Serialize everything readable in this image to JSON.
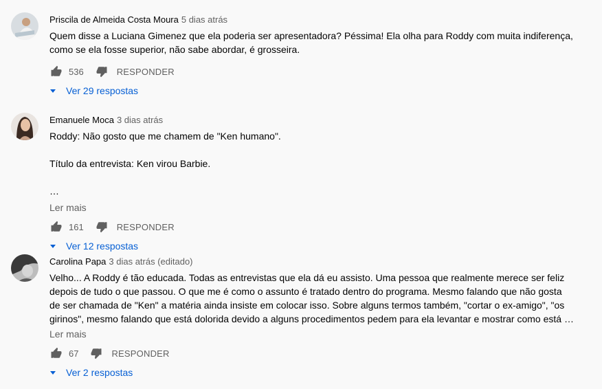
{
  "comments": [
    {
      "author": "Priscila de Almeida Costa Moura",
      "time": "5 dias atrás",
      "text": "Quem disse a Luciana Gimenez que ela poderia ser apresentadora? Péssima! Ela olha para Roddy com muita indiferença, como se ela fosse superior, não sabe abordar, é grosseira.",
      "likes": "536",
      "reply_label": "RESPONDER",
      "replies_label": "Ver 29 respostas"
    },
    {
      "author": "Emanuele Moca",
      "time": "3 dias atrás",
      "text": "Roddy: Não gosto que me chamem de \"Ken humano\".\n\nTítulo da entrevista: Ken virou Barbie.\n\n…",
      "read_more": "Ler mais",
      "likes": "161",
      "reply_label": "RESPONDER",
      "replies_label": "Ver 12 respostas"
    },
    {
      "author": "Carolina Papa",
      "time": "3 dias atrás (editado)",
      "text": "Velho... A Roddy é tão educada. Todas as entrevistas que ela dá eu assisto. Uma pessoa que realmente merece ser feliz depois de tudo o que passou. O que me é como o assunto é tratado dentro do programa. Mesmo falando que não gosta de ser chamada de \"Ken\" a matéria ainda insiste em colocar isso. Sobre alguns termos também, \"cortar o ex-amigo\", \"os girinos\", mesmo falando que está dolorida devido a alguns procedimentos pedem para ela levantar e mostrar como está …",
      "read_more": "Ler mais",
      "likes": "67",
      "reply_label": "RESPONDER",
      "replies_label": "Ver 2 respostas"
    }
  ],
  "icons": {
    "like": "thumb-up-icon",
    "dislike": "thumb-down-icon",
    "expand": "caret-down-icon"
  },
  "colors": {
    "link": "#065fd4",
    "secondary_text": "#606060",
    "background": "#f9f9f9"
  }
}
